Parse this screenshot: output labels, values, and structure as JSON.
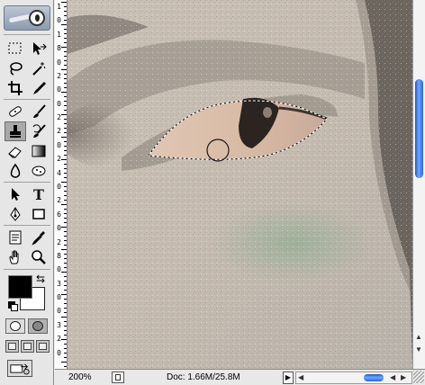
{
  "toolbox": {
    "tools": [
      {
        "name": "rectangular-marquee-tool",
        "row": 0,
        "col": 0
      },
      {
        "name": "move-tool",
        "row": 0,
        "col": 1
      },
      {
        "name": "lasso-tool",
        "row": 1,
        "col": 0
      },
      {
        "name": "magic-wand-tool",
        "row": 1,
        "col": 1
      },
      {
        "name": "crop-tool",
        "row": 2,
        "col": 0
      },
      {
        "name": "slice-tool",
        "row": 2,
        "col": 1
      },
      {
        "name": "healing-brush-tool",
        "row": 3,
        "col": 0
      },
      {
        "name": "brush-tool",
        "row": 3,
        "col": 1
      },
      {
        "name": "clone-stamp-tool",
        "row": 4,
        "col": 0,
        "selected": true
      },
      {
        "name": "history-brush-tool",
        "row": 4,
        "col": 1
      },
      {
        "name": "eraser-tool",
        "row": 5,
        "col": 0
      },
      {
        "name": "gradient-tool",
        "row": 5,
        "col": 1
      },
      {
        "name": "blur-tool",
        "row": 6,
        "col": 0
      },
      {
        "name": "dodge-tool",
        "row": 6,
        "col": 1
      },
      {
        "name": "path-selection-tool",
        "row": 7,
        "col": 0
      },
      {
        "name": "type-tool",
        "row": 7,
        "col": 1
      },
      {
        "name": "pen-tool",
        "row": 8,
        "col": 0
      },
      {
        "name": "rectangle-tool",
        "row": 8,
        "col": 1
      },
      {
        "name": "notes-tool",
        "row": 9,
        "col": 0
      },
      {
        "name": "eyedropper-tool",
        "row": 9,
        "col": 1
      },
      {
        "name": "hand-tool",
        "row": 10,
        "col": 0
      },
      {
        "name": "zoom-tool",
        "row": 10,
        "col": 1
      }
    ],
    "type_tool_glyph": "T",
    "foreground_color": "#000000",
    "background_color": "#ffffff"
  },
  "ruler": {
    "labels": [
      "1",
      "0",
      "1",
      "8",
      "0",
      "2",
      "0",
      "0",
      "2",
      "2",
      "0",
      "2",
      "4",
      "0",
      "2",
      "6",
      "0",
      "2",
      "8",
      "0",
      "3",
      "0",
      "0",
      "3",
      "2",
      "0"
    ]
  },
  "status": {
    "zoom": "200%",
    "doc_info": "Doc: 1.66M/25.8M"
  },
  "colors": {
    "scrollbar_accent": "#2a66d8",
    "selection_marquee": "#000000"
  }
}
